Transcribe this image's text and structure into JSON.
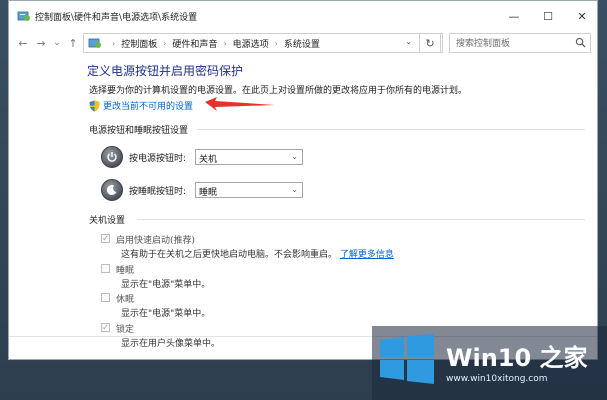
{
  "window": {
    "title": "控制面板\\硬件和声音\\电源选项\\系统设置",
    "controls": {
      "minimize": "—",
      "maximize": "☐",
      "close": "✕"
    }
  },
  "nav": {
    "back": "←",
    "forward": "→",
    "dropdown": "⌄",
    "up": "↑",
    "breadcrumbs": [
      "控制面板",
      "硬件和声音",
      "电源选项",
      "系统设置"
    ],
    "separator": "›",
    "refresh": "↻",
    "search_placeholder": "搜索控制面板"
  },
  "main": {
    "title": "定义电源按钮并启用密码保护",
    "description": "选择要为你的计算机设置的电源设置。在此页上对设置所做的更改将应用于你所有的电源计划。",
    "change_link": "更改当前不可用的设置",
    "power_section": {
      "heading": "电源按钮和睡眠按钮设置",
      "rows": [
        {
          "label": "按电源按钮时:",
          "value": "关机"
        },
        {
          "label": "按睡眠按钮时:",
          "value": "睡眠"
        }
      ]
    },
    "shutdown_section": {
      "heading": "关机设置",
      "options": [
        {
          "label": "启用快速启动(推荐)",
          "checked": true,
          "desc": "这有助于在关机之后更快地启动电脑。不会影响重启。",
          "link": "了解更多信息"
        },
        {
          "label": "睡眠",
          "checked": false,
          "desc": "显示在\"电源\"菜单中。"
        },
        {
          "label": "休眠",
          "checked": false,
          "desc": "显示在\"电源\"菜单中。"
        },
        {
          "label": "锁定",
          "checked": true,
          "desc": "显示在用户头像菜单中。"
        }
      ]
    }
  },
  "watermark": {
    "brand": "Win10 之家",
    "url": "www.win10xitong.com"
  },
  "colors": {
    "link": "#0066cc",
    "title": "#1e3287",
    "arrow": "#e8312a",
    "win_blue": "#2f9ae0"
  }
}
